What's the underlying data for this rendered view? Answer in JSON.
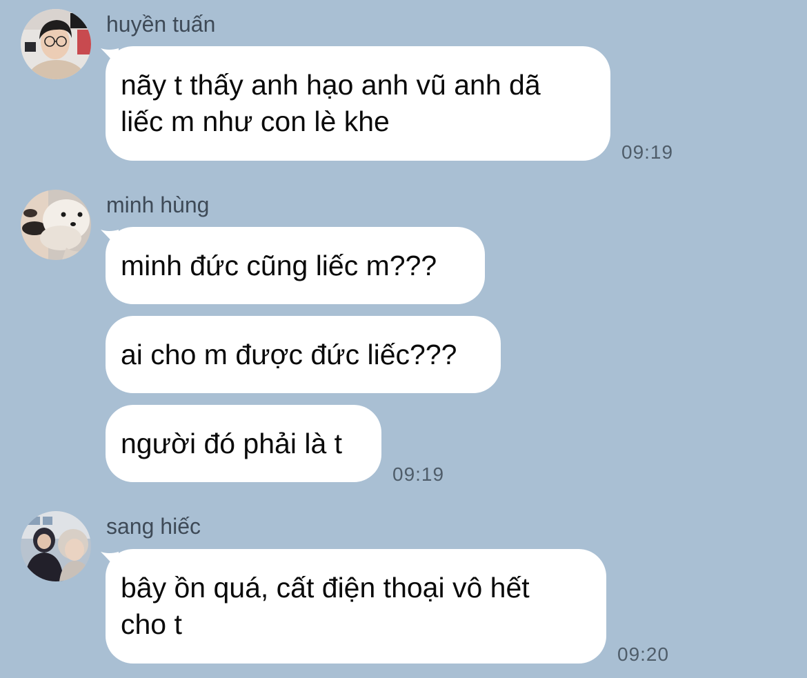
{
  "theme": {
    "background": "#a9bfd3",
    "bubble": "#ffffff",
    "text": "#0a0a0a",
    "meta_text": "#4f5d6a"
  },
  "messages": [
    {
      "sender": "huyền tuấn",
      "avatar": "profile-photo-boy-glasses",
      "bubbles": [
        {
          "lines": [
            "nãy t thấy anh hạo anh vũ anh dã",
            "liếc m như con lè khe"
          ]
        }
      ],
      "time": "09:19"
    },
    {
      "sender": "minh hùng",
      "avatar": "profile-photo-white-dog",
      "bubbles": [
        {
          "lines": [
            "minh đức cũng liếc m???"
          ]
        },
        {
          "lines": [
            "ai cho m được đức liếc???"
          ]
        },
        {
          "lines": [
            "người đó phải là t"
          ]
        }
      ],
      "time": "09:19"
    },
    {
      "sender": "sang hiếc",
      "avatar": "profile-photo-two-people",
      "bubbles": [
        {
          "lines": [
            "bây ồn quá, cất điện thoại vô hết",
            "cho t"
          ]
        }
      ],
      "time": "09:20"
    }
  ]
}
